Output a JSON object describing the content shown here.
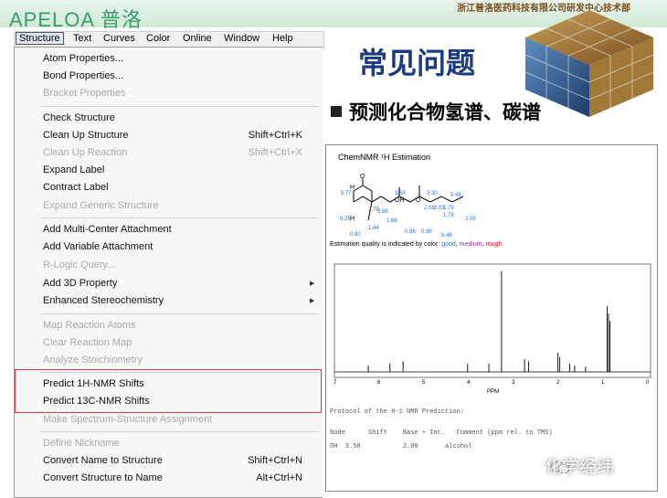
{
  "header": {
    "logo": "APELOA 普洛",
    "company": "浙江普洛医药科技有限公司研发中心技术部"
  },
  "slide": {
    "title": "常见问题",
    "subtitle": "预测化合物氢谱、碳谱"
  },
  "menubar": {
    "items": [
      "Structure",
      "Text",
      "Curves",
      "Color",
      "Online",
      "Window",
      "Help"
    ]
  },
  "menu": {
    "items": [
      {
        "label": "Atom Properties...",
        "shortcut": "",
        "disabled": false
      },
      {
        "label": "Bond Properties...",
        "shortcut": "",
        "disabled": false
      },
      {
        "label": "Bracket Properties",
        "shortcut": "",
        "disabled": true
      },
      {
        "label": "Check Structure",
        "shortcut": "",
        "disabled": false
      },
      {
        "label": "Clean Up Structure",
        "shortcut": "Shift+Ctrl+K",
        "disabled": false
      },
      {
        "label": "Clean Up Reaction",
        "shortcut": "Shift+Ctrl+X",
        "disabled": true
      },
      {
        "label": "Expand Label",
        "shortcut": "",
        "disabled": false
      },
      {
        "label": "Contract Label",
        "shortcut": "",
        "disabled": false
      },
      {
        "label": "Expand Generic Structure",
        "shortcut": "",
        "disabled": true
      },
      {
        "label": "Add Multi-Center Attachment",
        "shortcut": "",
        "disabled": false
      },
      {
        "label": "Add Variable Attachment",
        "shortcut": "",
        "disabled": false
      },
      {
        "label": "R-Logic Query...",
        "shortcut": "",
        "disabled": true
      },
      {
        "label": "Add 3D Property",
        "shortcut": "",
        "disabled": false
      },
      {
        "label": "Enhanced Stereochemistry",
        "shortcut": "",
        "disabled": false
      },
      {
        "label": "Map Reaction Atoms",
        "shortcut": "",
        "disabled": true
      },
      {
        "label": "Clear Reaction Map",
        "shortcut": "",
        "disabled": true
      },
      {
        "label": "Analyze Stoichiometry",
        "shortcut": "",
        "disabled": true
      },
      {
        "label": "Predict 1H-NMR Shifts",
        "shortcut": "",
        "disabled": false
      },
      {
        "label": "Predict 13C-NMR Shifts",
        "shortcut": "",
        "disabled": false
      },
      {
        "label": "Make Spectrum-Structure Assignment",
        "shortcut": "",
        "disabled": true
      },
      {
        "label": "Define Nickname",
        "shortcut": "",
        "disabled": true
      },
      {
        "label": "Convert Name to Structure",
        "shortcut": "Shift+Ctrl+N",
        "disabled": false
      },
      {
        "label": "Convert Structure to Name",
        "shortcut": "Alt+Ctrl+N",
        "disabled": false
      }
    ]
  },
  "nmr": {
    "title": "ChemNMR ¹H Estimation",
    "structure_labels": [
      "5.77",
      "6.25",
      "0.90",
      "1.44",
      "2.79",
      "3.88",
      "1.68",
      "3.58",
      "OH",
      "O",
      "3.30",
      "2.09",
      "2.01",
      "1.79",
      "1.76",
      "5.48",
      "2.05",
      "5.48",
      "0.96",
      "0.96",
      "O",
      "H",
      "H"
    ],
    "quality_prefix": "Estimation quality is indicated by color:",
    "quality_good": "good",
    "quality_medium": "medium",
    "quality_rough": "rough",
    "axis_unit": "PPM",
    "axis_ticks": [
      "7",
      "6",
      "5",
      "4",
      "3",
      "2",
      "1",
      "0"
    ],
    "protocol": "Protocol of the H-1 NMR Prediction:",
    "table_header": "Node      Shift    Base + Inc.   Comment (ppm rel. to TMS)",
    "table_row": "OH  3.58           2.00       alcohol"
  },
  "watermark": "化学经纬",
  "colors": {
    "highlight": "#d9383c",
    "title": "#1d3b82"
  }
}
